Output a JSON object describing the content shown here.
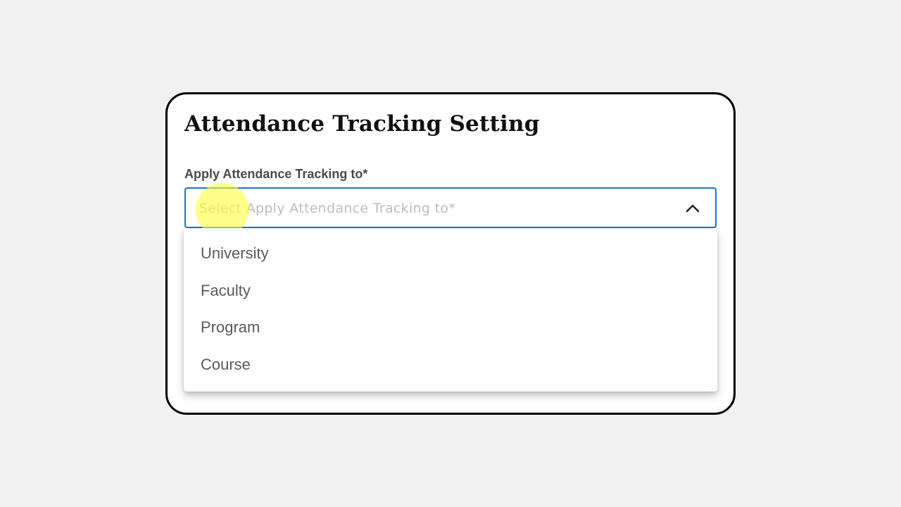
{
  "card": {
    "title": "Attendance Tracking Setting"
  },
  "field": {
    "label": "Apply Attendance Tracking to*",
    "placeholder": "Select Apply Attendance Tracking to*",
    "chevron_icon": "chevron-up-icon",
    "focus_color": "#1a73c9"
  },
  "dropdown": {
    "options": [
      {
        "label": "University"
      },
      {
        "label": "Faculty"
      },
      {
        "label": "Program"
      },
      {
        "label": "Course"
      }
    ]
  }
}
